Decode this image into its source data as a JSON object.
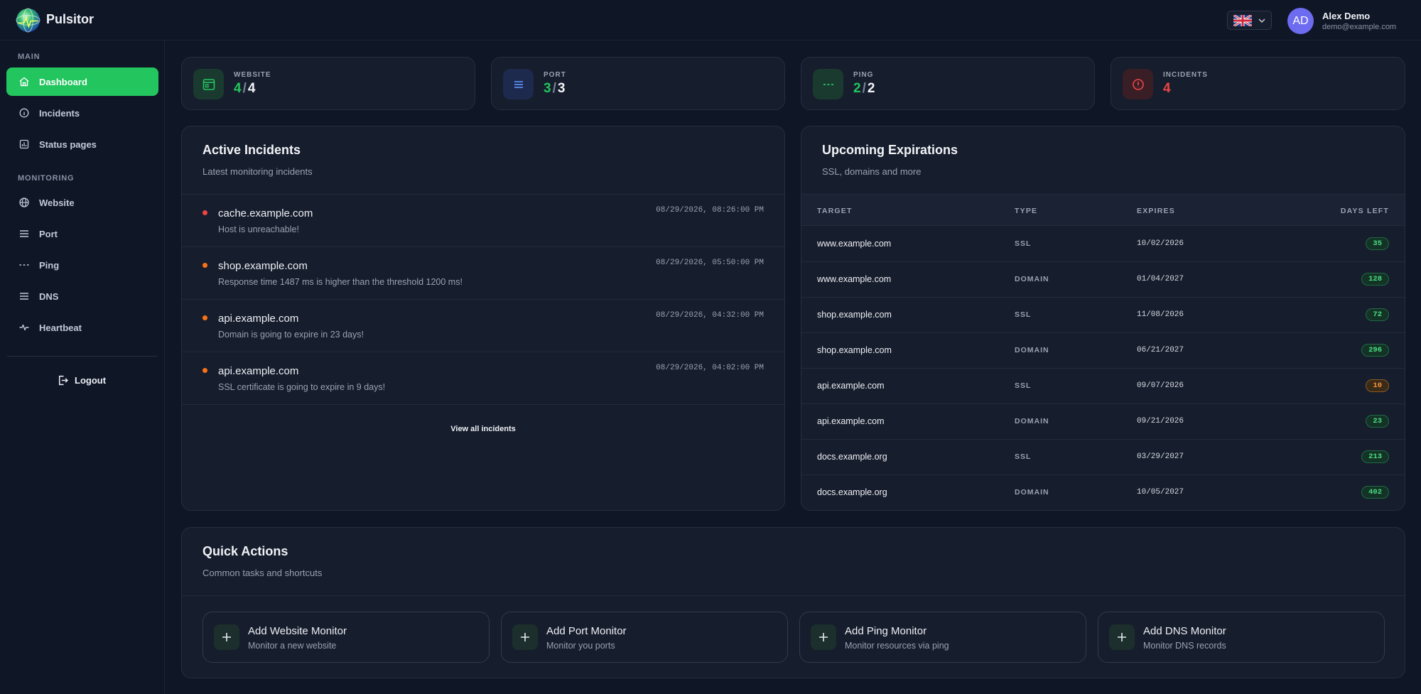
{
  "app": {
    "name": "Pulsitor"
  },
  "header": {
    "language_flag": "uk-flag-icon",
    "user": {
      "initials": "AD",
      "name": "Alex Demo",
      "email": "demo@example.com"
    }
  },
  "sidebar": {
    "sections": [
      {
        "label": "MAIN",
        "items": [
          {
            "label": "Dashboard",
            "icon": "home-icon",
            "active": true
          },
          {
            "label": "Incidents",
            "icon": "info-icon"
          },
          {
            "label": "Status pages",
            "icon": "chart-icon"
          }
        ]
      },
      {
        "label": "MONITORING",
        "items": [
          {
            "label": "Website",
            "icon": "globe-icon"
          },
          {
            "label": "Port",
            "icon": "lines-icon"
          },
          {
            "label": "Ping",
            "icon": "dashes-icon"
          },
          {
            "label": "DNS",
            "icon": "lines-icon"
          },
          {
            "label": "Heartbeat",
            "icon": "pulse-icon"
          }
        ]
      }
    ],
    "logout_label": "Logout"
  },
  "stats": [
    {
      "label": "WEBSITE",
      "up": "4",
      "total": "4"
    },
    {
      "label": "PORT",
      "up": "3",
      "total": "3"
    },
    {
      "label": "PING",
      "up": "2",
      "total": "2"
    },
    {
      "label": "INCIDENTS",
      "value": "4"
    }
  ],
  "active_incidents": {
    "title": "Active Incidents",
    "subtitle": "Latest monitoring incidents",
    "items": [
      {
        "host": "cache.example.com",
        "message": "Host is unreachable!",
        "time": "08/29/2026, 08:26:00 PM",
        "severity": "red"
      },
      {
        "host": "shop.example.com",
        "message": "Response time 1487 ms is higher than the threshold 1200 ms!",
        "time": "08/29/2026, 05:50:00 PM",
        "severity": "orange"
      },
      {
        "host": "api.example.com",
        "message": "Domain is going to expire in 23 days!",
        "time": "08/29/2026, 04:32:00 PM",
        "severity": "orange"
      },
      {
        "host": "api.example.com",
        "message": "SSL certificate is going to expire in 9 days!",
        "time": "08/29/2026, 04:02:00 PM",
        "severity": "orange"
      }
    ],
    "view_all_label": "View all incidents"
  },
  "expirations": {
    "title": "Upcoming Expirations",
    "subtitle": "SSL, domains and more",
    "columns": [
      "TARGET",
      "TYPE",
      "EXPIRES",
      "DAYS LEFT"
    ],
    "rows": [
      {
        "target": "www.example.com",
        "type": "SSL",
        "expires": "10/02/2026",
        "days": "35",
        "level": "ok"
      },
      {
        "target": "www.example.com",
        "type": "DOMAIN",
        "expires": "01/04/2027",
        "days": "128",
        "level": "ok"
      },
      {
        "target": "shop.example.com",
        "type": "SSL",
        "expires": "11/08/2026",
        "days": "72",
        "level": "ok"
      },
      {
        "target": "shop.example.com",
        "type": "DOMAIN",
        "expires": "06/21/2027",
        "days": "296",
        "level": "ok"
      },
      {
        "target": "api.example.com",
        "type": "SSL",
        "expires": "09/07/2026",
        "days": "10",
        "level": "warn"
      },
      {
        "target": "api.example.com",
        "type": "DOMAIN",
        "expires": "09/21/2026",
        "days": "23",
        "level": "ok"
      },
      {
        "target": "docs.example.org",
        "type": "SSL",
        "expires": "03/29/2027",
        "days": "213",
        "level": "ok"
      },
      {
        "target": "docs.example.org",
        "type": "DOMAIN",
        "expires": "10/05/2027",
        "days": "402",
        "level": "ok"
      }
    ]
  },
  "quick_actions": {
    "title": "Quick Actions",
    "subtitle": "Common tasks and shortcuts",
    "items": [
      {
        "title": "Add Website Monitor",
        "subtitle": "Monitor a new website"
      },
      {
        "title": "Add Port Monitor",
        "subtitle": "Monitor you ports"
      },
      {
        "title": "Add Ping Monitor",
        "subtitle": "Monitor resources via ping"
      },
      {
        "title": "Add DNS Monitor",
        "subtitle": "Monitor DNS records"
      }
    ]
  },
  "colors": {
    "accent": "#22c55e",
    "danger": "#ef4444",
    "warning": "#f97316",
    "avatar": "#6d6cf0"
  }
}
